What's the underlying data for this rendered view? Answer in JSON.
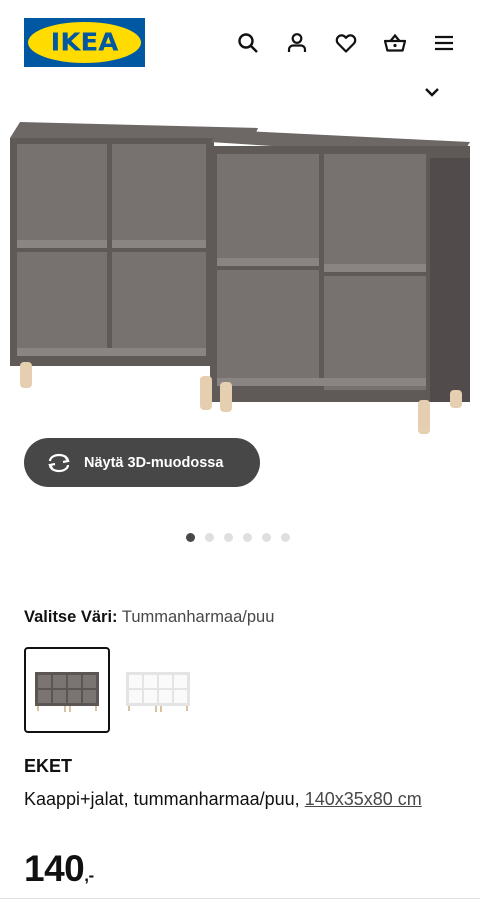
{
  "header": {
    "logo_text": "IKEA",
    "icons": [
      "search-icon",
      "user-icon",
      "heart-icon",
      "basket-icon",
      "menu-icon"
    ],
    "brand_blue": "#0058a3",
    "brand_yellow": "#ffdb00"
  },
  "gallery": {
    "button_3d_label": "Näytä 3D-muodossa",
    "dots_count": 6,
    "active_dot": 1
  },
  "color_select": {
    "label": "Valitse Väri:",
    "value": "Tummanharmaa/puu",
    "options": [
      "dark-grey",
      "white"
    ],
    "selected": "dark-grey"
  },
  "product": {
    "name": "EKET",
    "description": "Kaappi+jalat, tummanharmaa/puu,",
    "dimensions": "140x35x80 cm",
    "price": "140",
    "price_suffix": ",-"
  }
}
